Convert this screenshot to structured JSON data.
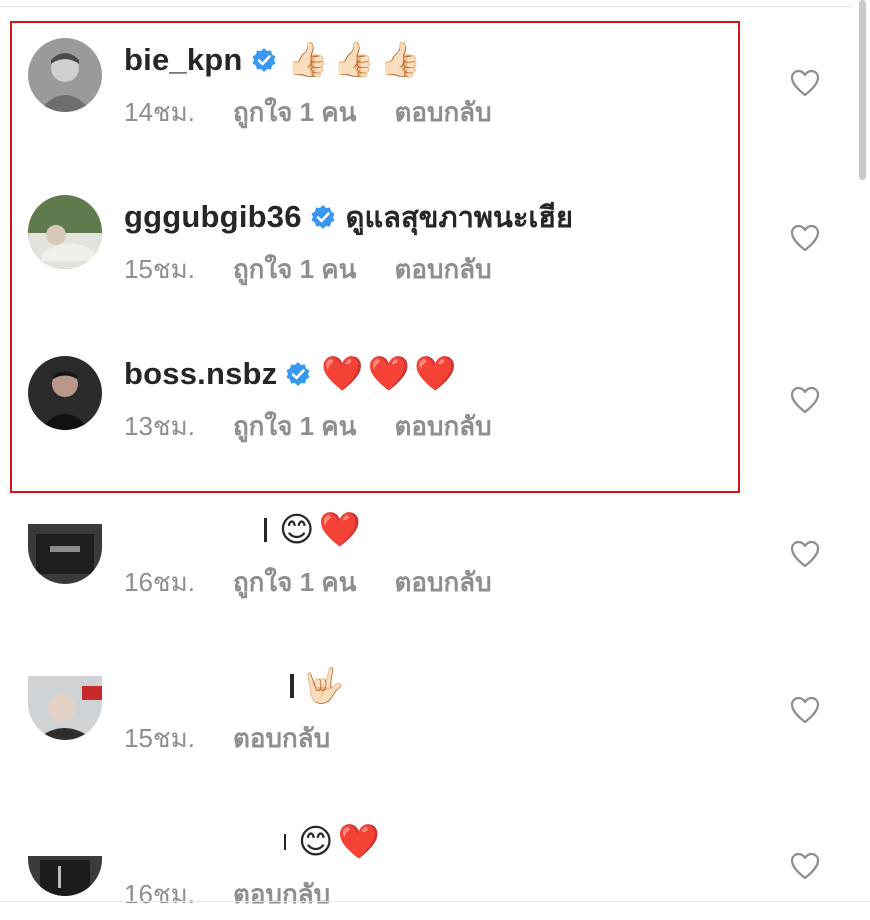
{
  "comments": [
    {
      "username": "bie_kpn",
      "verified": true,
      "text": "",
      "emojis": [
        "👍🏻",
        "👍🏻",
        "👍🏻"
      ],
      "time": "14ชม.",
      "likes": "ถูกใจ 1 คน",
      "reply": "ตอบกลับ"
    },
    {
      "username": "gggubgib36",
      "verified": true,
      "text": "ดูแลสุขภาพนะเฮีย",
      "emojis": [],
      "time": "15ชม.",
      "likes": "ถูกใจ 1 คน",
      "reply": "ตอบกลับ"
    },
    {
      "username": "boss.nsbz",
      "verified": true,
      "text": "",
      "emojis": [
        "❤️",
        "❤️",
        "❤️"
      ],
      "time": "13ชม.",
      "likes": "ถูกใจ 1 คน",
      "reply": "ตอบกลับ"
    },
    {
      "username": "",
      "verified": false,
      "text": "",
      "emojis": [
        "😊",
        "❤️"
      ],
      "time": "16ชม.",
      "likes": "ถูกใจ 1 คน",
      "reply": "ตอบกลับ"
    },
    {
      "username": "",
      "verified": false,
      "text": "",
      "emojis": [
        "🤟🏻"
      ],
      "time": "15ชม.",
      "likes": "",
      "reply": "ตอบกลับ"
    },
    {
      "username": "",
      "verified": false,
      "text": "",
      "emojis": [
        "😊",
        "❤️"
      ],
      "time": "16ชม.",
      "likes": "",
      "reply": "ตอบกลับ"
    }
  ],
  "colors": {
    "highlight": "#d2141b",
    "verified": "#3897f0",
    "meta": "#8e8e8e",
    "text": "#262626"
  },
  "icons": {
    "like": "heart-outline-icon",
    "verified": "verified-badge-icon"
  }
}
